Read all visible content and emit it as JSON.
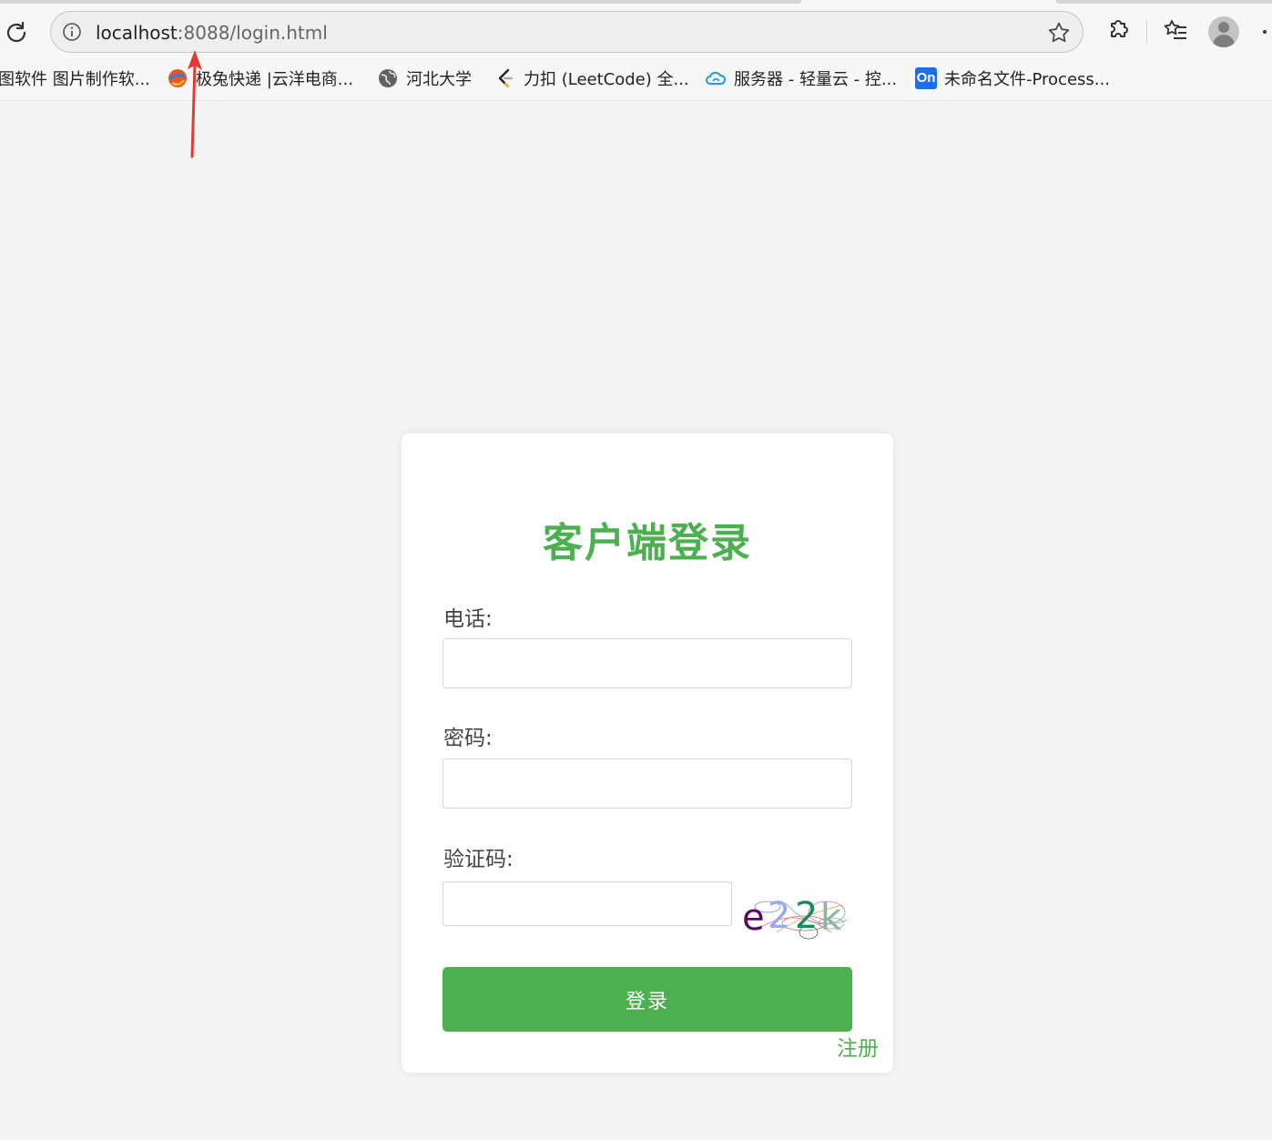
{
  "browser": {
    "url_host": "localhost",
    "url_rest": ":8088/login.html",
    "bookmarks": [
      {
        "label": "图软件 图片制作软...",
        "icon": "none"
      },
      {
        "label": "极兔快递 |云洋电商...",
        "icon": "swirl-logo-icon"
      },
      {
        "label": "河北大学",
        "icon": "globe-icon"
      },
      {
        "label": "力扣 (LeetCode) 全...",
        "icon": "leetcode-icon"
      },
      {
        "label": "服务器 - 轻量云 - 控...",
        "icon": "cloud-icon"
      },
      {
        "label": "未命名文件-Process...",
        "icon": "processon-icon"
      }
    ],
    "processon_badge": "On"
  },
  "login": {
    "title": "客户端登录",
    "phone_label": "电话:",
    "phone_value": "",
    "password_label": "密码:",
    "password_value": "",
    "captcha_label": "验证码:",
    "captcha_value": "",
    "captcha_text": [
      "e",
      "2",
      "2",
      "k"
    ],
    "captcha_colors": [
      "#5a0a5e",
      "#9fa8e8",
      "#1a8a5a",
      "#8fb5a0"
    ],
    "submit_label": "登录",
    "register_label": "注册"
  },
  "colors": {
    "accent": "#4caf50",
    "annotation_arrow": "#e53935"
  }
}
